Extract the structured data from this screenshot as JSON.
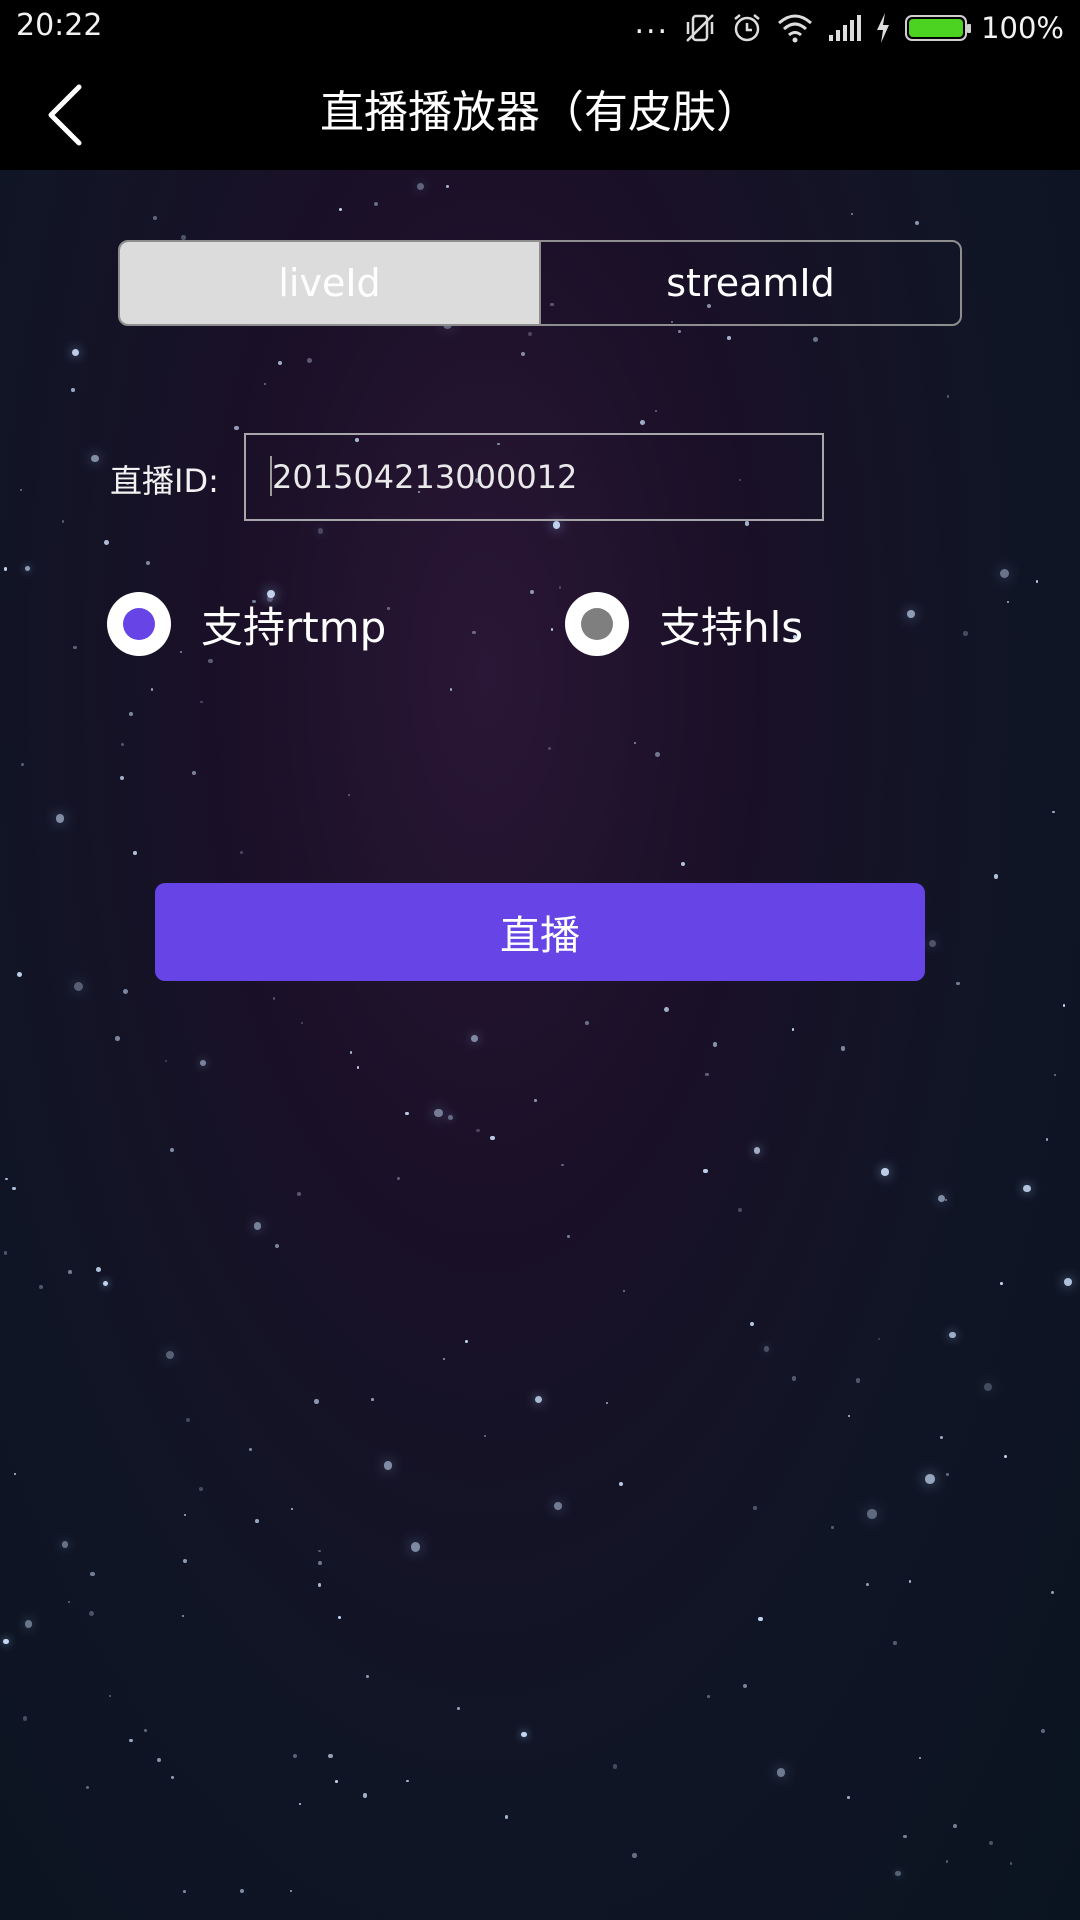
{
  "status_bar": {
    "time": "20:22",
    "overflow_dots": "...",
    "battery_percent": "100%",
    "battery_level": 1.0,
    "battery_color": "#4cd221",
    "icons": [
      "mute-vibrate-icon",
      "alarm-icon",
      "wifi-icon",
      "signal-icon",
      "charging-bolt-icon",
      "battery-icon"
    ]
  },
  "header": {
    "title": "直播播放器（有皮肤）",
    "back_icon": "chevron-left-icon"
  },
  "segmented": {
    "options": [
      {
        "label": "liveId",
        "selected": true
      },
      {
        "label": "streamId",
        "selected": false
      }
    ]
  },
  "form": {
    "id_label": "直播ID:",
    "id_value": "201504213000012"
  },
  "protocols": {
    "options": [
      {
        "label": "支持rtmp",
        "selected": true,
        "dot_color": "#6644e6"
      },
      {
        "label": "支持hls",
        "selected": false,
        "dot_color": "#7f7f7f"
      }
    ]
  },
  "actions": {
    "live_button": "直播",
    "accent_color": "#6644e6"
  }
}
